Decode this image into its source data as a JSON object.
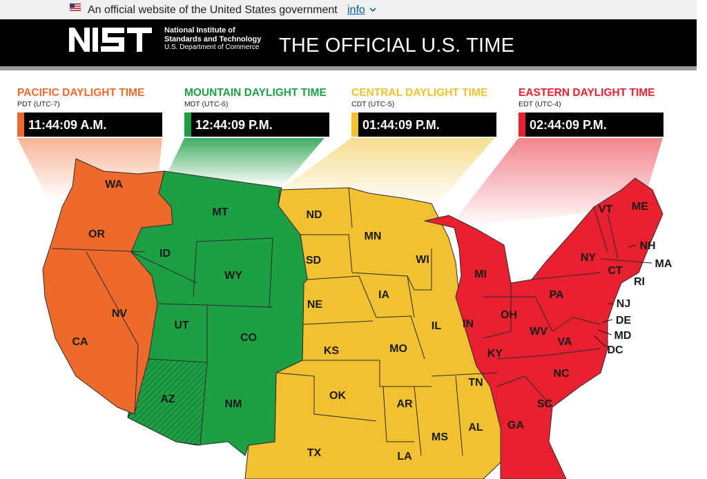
{
  "banner": {
    "text": "An official website of the United States government",
    "info_link": "info",
    "flag_icon": "us-flag-icon",
    "chevron_icon": "chevron-down-icon"
  },
  "header": {
    "logo_text": "NIST",
    "org_line1": "National Institute of",
    "org_line2": "Standards and Technology",
    "org_line3": "U.S. Department of Commerce",
    "title": "THE OFFICIAL U.S. TIME"
  },
  "colors": {
    "pacific": "#ee6a2c",
    "mountain": "#1f9f45",
    "central": "#f1c132",
    "eastern": "#e8202f"
  },
  "zones": [
    {
      "name": "PACIFIC DAYLIGHT TIME",
      "abbr": "PDT (UTC-7)",
      "time": "11:44:09 A.M."
    },
    {
      "name": "MOUNTAIN DAYLIGHT TIME",
      "abbr": "MDT (UTC-6)",
      "time": "12:44:09 P.M."
    },
    {
      "name": "CENTRAL DAYLIGHT TIME",
      "abbr": "CDT (UTC-5)",
      "time": "01:44:09 P.M."
    },
    {
      "name": "EASTERN DAYLIGHT TIME",
      "abbr": "EDT (UTC-4)",
      "time": "02:44:09 P.M."
    }
  ],
  "map": {
    "states": {
      "WA": "WA",
      "OR": "OR",
      "CA": "CA",
      "NV": "NV",
      "ID": "ID",
      "MT": "MT",
      "WY": "WY",
      "UT": "UT",
      "CO": "CO",
      "AZ": "AZ",
      "NM": "NM",
      "ND": "ND",
      "SD": "SD",
      "NE": "NE",
      "KS": "KS",
      "OK": "OK",
      "TX": "TX",
      "MN": "MN",
      "IA": "IA",
      "MO": "MO",
      "AR": "AR",
      "LA": "LA",
      "WI": "WI",
      "IL": "IL",
      "TN": "TN",
      "MS": "MS",
      "AL": "AL",
      "MI": "MI",
      "IN": "IN",
      "OH": "OH",
      "KY": "KY",
      "WV": "WV",
      "VA": "VA",
      "PA": "PA",
      "NY": "NY",
      "VT": "VT",
      "ME": "ME",
      "NH": "NH",
      "MA": "MA",
      "CT": "CT",
      "RI": "RI",
      "NJ": "NJ",
      "DE": "DE",
      "MD": "MD",
      "DC": "DC",
      "NC": "NC",
      "SC": "SC",
      "GA": "GA"
    }
  }
}
